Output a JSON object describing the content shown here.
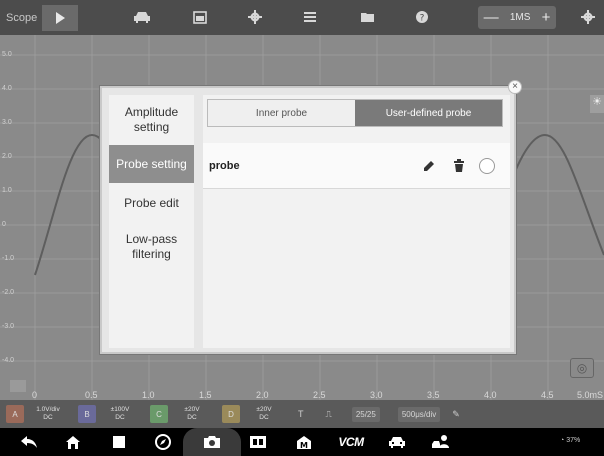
{
  "app": {
    "title": "Scope"
  },
  "toolbar": {
    "icons": [
      "play-icon",
      "car-icon",
      "calendar-icon",
      "gear-icon",
      "list-icon",
      "folder-icon",
      "help-icon"
    ],
    "timebase": {
      "minus": "—",
      "value": "1MS",
      "plus": "+"
    },
    "right_icon": "gear-icon"
  },
  "scope": {
    "y_ticks": [
      "5.0",
      "4.0",
      "3.0",
      "2.0",
      "1.0",
      "0",
      "-1.0",
      "-2.0",
      "-3.0",
      "-4.0",
      "-5.0"
    ],
    "x_ticks": [
      "0",
      "0.5",
      "1.0",
      "1.5",
      "2.0",
      "2.5",
      "3.0",
      "3.5",
      "4.0",
      "4.5",
      "5.0"
    ],
    "x_unit": "mS"
  },
  "channels": [
    {
      "label": "A",
      "range": "1.0V/div",
      "coupling": "DC",
      "color": "#9a6a5a"
    },
    {
      "label": "B",
      "range": "±100V",
      "coupling": "DC",
      "color": "#6a6a9a"
    },
    {
      "label": "C",
      "range": "±20V",
      "coupling": "DC",
      "color": "#6a9a6a"
    },
    {
      "label": "D",
      "range": "±20V",
      "coupling": "DC",
      "color": "#9a8a5a"
    }
  ],
  "chanbar_misc": {
    "trigger": "T",
    "edge": "⎍",
    "page": "25/25",
    "timediv": "500μs/div"
  },
  "dialog": {
    "menu": [
      {
        "label": "Amplitude setting",
        "active": false
      },
      {
        "label": "Probe setting",
        "active": true
      },
      {
        "label": "Probe edit",
        "active": false
      },
      {
        "label": "Low-pass filtering",
        "active": false
      }
    ],
    "tabs": [
      {
        "label": "Inner probe",
        "selected": false
      },
      {
        "label": "User-defined probe",
        "selected": true
      }
    ],
    "rows": [
      {
        "label": "probe"
      }
    ],
    "close": "×"
  },
  "navbar": {
    "items": [
      "back-icon",
      "home-icon",
      "recent-apps-icon",
      "browser-icon",
      "camera-icon",
      "screen-record-icon",
      "maxifix-icon",
      "vcm-icon",
      "car-icon",
      "user-car-icon"
    ],
    "vcm_label": "VCM",
    "status": "37%"
  },
  "colors": {
    "accent": "#8e8e8e",
    "waveform": "#5e5e5e",
    "grid": "#9b9b9b"
  }
}
